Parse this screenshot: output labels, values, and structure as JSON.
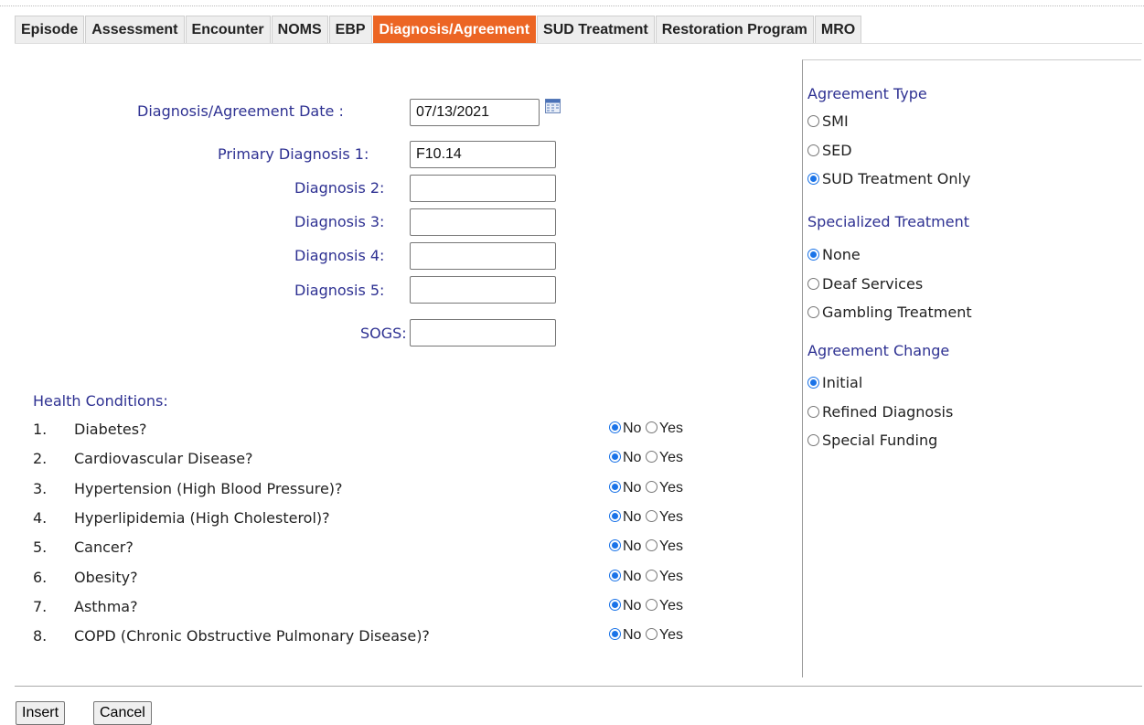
{
  "tabs": [
    {
      "label": "Episode",
      "active": false
    },
    {
      "label": "Assessment",
      "active": false
    },
    {
      "label": "Encounter",
      "active": false
    },
    {
      "label": "NOMS",
      "active": false
    },
    {
      "label": "EBP",
      "active": false
    },
    {
      "label": "Diagnosis/Agreement",
      "active": true
    },
    {
      "label": "SUD Treatment",
      "active": false
    },
    {
      "label": "Restoration Program",
      "active": false
    },
    {
      "label": "MRO",
      "active": false
    }
  ],
  "colors": {
    "active_tab": "#ec6524",
    "label_text": "#2e3192",
    "radio_selected": "#1a73e8"
  },
  "form": {
    "date_label": "Diagnosis/Agreement Date :",
    "date_value": "07/13/2021",
    "primary_label": "Primary Diagnosis 1:",
    "primary_value": "F10.14",
    "dx2_label": "Diagnosis 2:",
    "dx2_value": "",
    "dx3_label": "Diagnosis 3:",
    "dx3_value": "",
    "dx4_label": "Diagnosis 4:",
    "dx4_value": "",
    "dx5_label": "Diagnosis 5:",
    "dx5_value": "",
    "sogs_label": "SOGS:",
    "sogs_value": "",
    "calendar_icon": "calendar-icon"
  },
  "health": {
    "title": "Health Conditions:",
    "no_label": "No",
    "yes_label": "Yes",
    "items": [
      {
        "num": "1.",
        "text": "Diabetes?",
        "value": "No"
      },
      {
        "num": "2.",
        "text": "Cardiovascular Disease?",
        "value": "No"
      },
      {
        "num": "3.",
        "text": "Hypertension (High Blood Pressure)?",
        "value": "No"
      },
      {
        "num": "4.",
        "text": "Hyperlipidemia (High Cholesterol)?",
        "value": "No"
      },
      {
        "num": "5.",
        "text": "Cancer?",
        "value": "No"
      },
      {
        "num": "6.",
        "text": "Obesity?",
        "value": "No"
      },
      {
        "num": "7.",
        "text": "Asthma?",
        "value": "No"
      },
      {
        "num": "8.",
        "text": "COPD (Chronic Obstructive Pulmonary Disease)?",
        "value": "No"
      }
    ]
  },
  "agreement_type": {
    "title": "Agreement Type",
    "options": [
      "SMI",
      "SED",
      "SUD Treatment Only"
    ],
    "selected": "SUD Treatment Only"
  },
  "specialized_treatment": {
    "title": "Specialized Treatment",
    "options": [
      "None",
      "Deaf Services",
      "Gambling Treatment"
    ],
    "selected": "None"
  },
  "agreement_change": {
    "title": "Agreement Change",
    "options": [
      "Initial",
      "Refined Diagnosis",
      "Special Funding"
    ],
    "selected": "Initial"
  },
  "buttons": {
    "insert": "Insert",
    "cancel": "Cancel"
  }
}
